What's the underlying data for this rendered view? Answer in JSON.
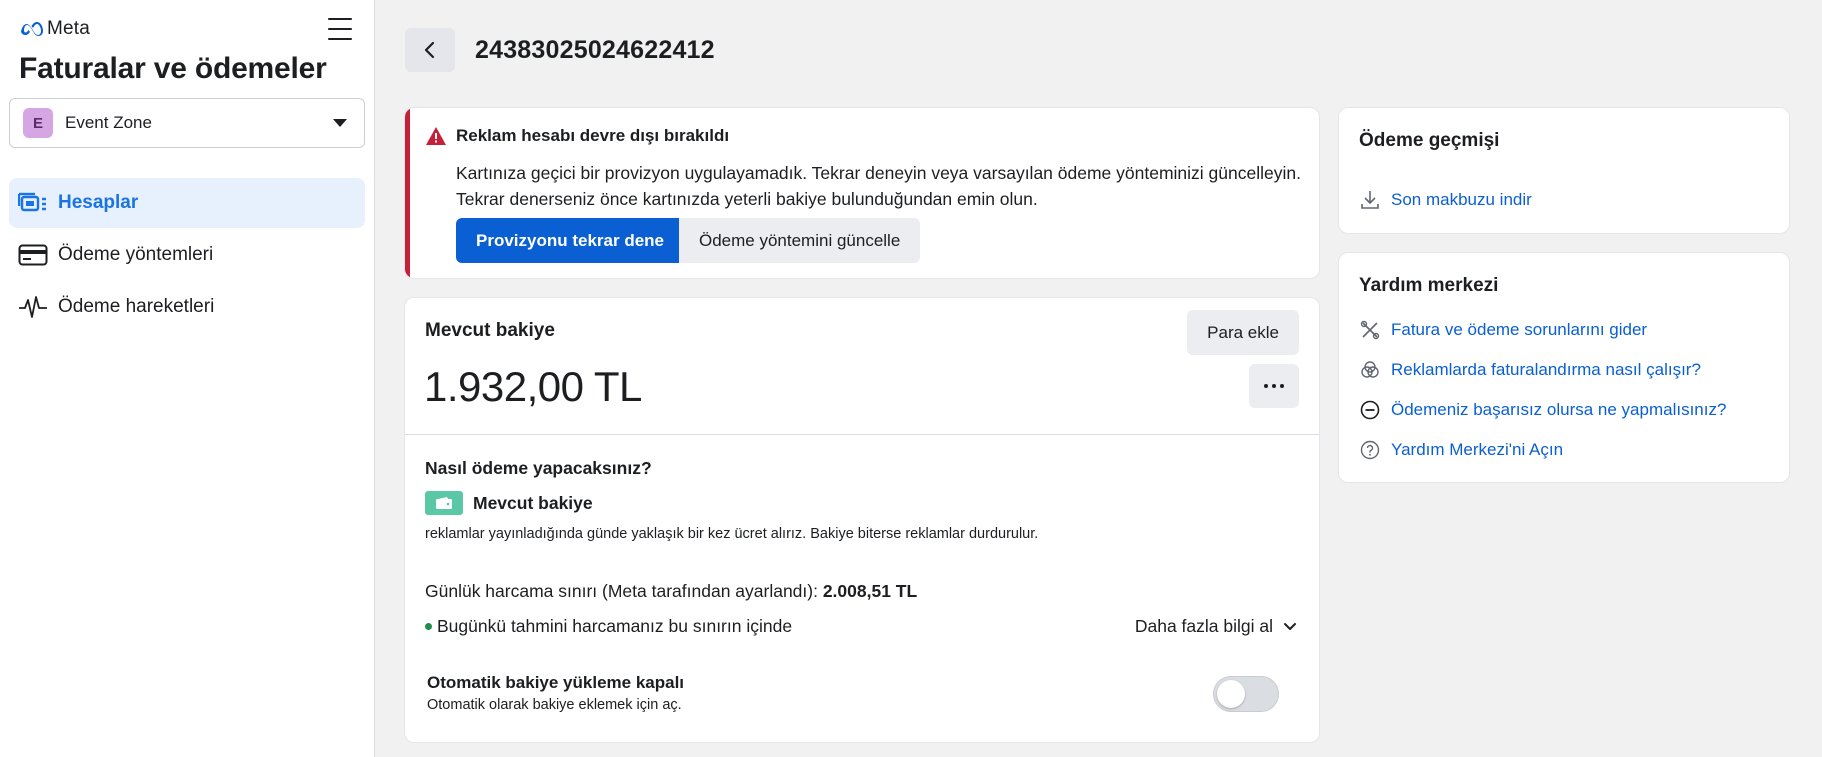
{
  "sidebar": {
    "brand": "Meta",
    "title": "Faturalar ve ödemeler",
    "account": {
      "initial": "E",
      "name": "Event Zone"
    },
    "items": [
      {
        "label": "Hesaplar",
        "icon": "accounts-icon",
        "active": true
      },
      {
        "label": "Ödeme yöntemleri",
        "icon": "credit-card-icon",
        "active": false
      },
      {
        "label": "Ödeme hareketleri",
        "icon": "activity-icon",
        "active": false
      }
    ]
  },
  "header": {
    "account_id": "2438302502462241​2"
  },
  "alert": {
    "title": "Reklam hesabı devre dışı bırakıldı",
    "body": "Kartınıza geçici bir provizyon uygulayamadık. Tekrar deneyin veya varsayılan ödeme yönteminizi güncelleyin. Tekrar denerseniz önce kartınızda yeterli bakiye bulunduğundan emin olun.",
    "primary_label": "Provizyonu tekrar dene",
    "secondary_label": "Ödeme yöntemini güncelle",
    "color": "#c51f3a"
  },
  "balance": {
    "title": "Mevcut bakiye",
    "add_label": "Para ekle",
    "amount": "1.932,00 TL",
    "how_title": "Nasıl ödeme yapacaksınız?",
    "method_label": "Mevcut bakiye",
    "method_desc": "reklamlar yayınladığında günde yaklaşık bir kez ücret alırız. Bakiye biterse reklamlar durdurulur.",
    "limit_text": "Günlük harcama sınırı (Meta tarafından ayarlandı): ",
    "limit_value": "2.008,51 TL",
    "status_text": "Bugünkü tahmini harcamanız bu sınırın içinde",
    "more_info": "Daha fazla bilgi al",
    "auto_title": "Otomatik bakiye yükleme kapalı",
    "auto_sub": "Otomatik olarak bakiye eklemek için aç.",
    "auto_enabled": false
  },
  "history": {
    "title": "Ödeme geçmişi",
    "download_label": "Son makbuzu indir"
  },
  "help": {
    "title": "Yardım merkezi",
    "links": [
      {
        "label": "Fatura ve ödeme sorunlarını gider",
        "icon": "tools-icon"
      },
      {
        "label": "Reklamlarda faturalandırma nasıl çalışır?",
        "icon": "circles-icon"
      },
      {
        "label": "Ödemeniz başarısız olursa ne yapmalısınız?",
        "icon": "minus-circle-icon"
      },
      {
        "label": "Yardım Merkezi'ni Açın",
        "icon": "question-circle-icon"
      }
    ]
  },
  "colors": {
    "accent": "#0a5fd2",
    "active_nav": "#1b74e4",
    "active_bg": "#e7f0fd"
  }
}
